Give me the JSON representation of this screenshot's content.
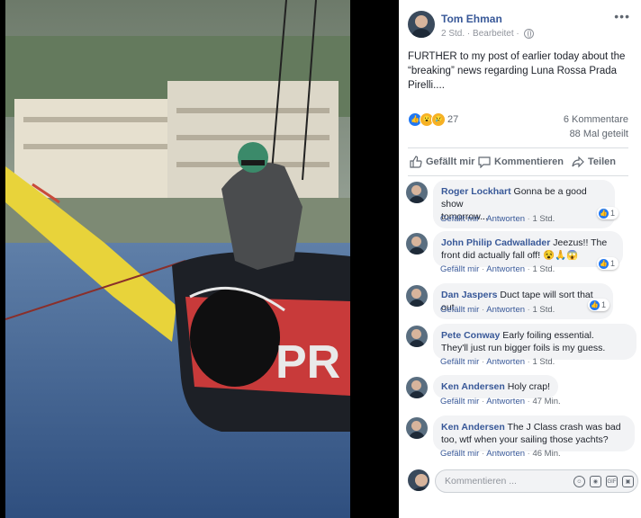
{
  "post": {
    "author": "Tom Ehman",
    "time": "2 Std.",
    "edited": "Bearbeitet",
    "separator": "·",
    "text": "FURTHER to my post of earlier today about the “breaking” news regarding Luna Rossa Prada Pirelli....",
    "reaction_count": "27",
    "comments_count": "6 Kommentare",
    "shares_count": "88 Mal geteilt",
    "photo_text": "PR"
  },
  "actions": {
    "like": "Gefällt mir",
    "comment": "Kommentieren",
    "share": "Teilen"
  },
  "comments": [
    {
      "name": "Roger Lockhart",
      "text": "Gonna be a good show tomorrow...",
      "line1": "Gonna be a good show",
      "line2": "tomorrow...",
      "like": "Gefällt mir",
      "reply": "Antworten",
      "time": "1 Std.",
      "likes": "1"
    },
    {
      "name": "John Philip Cadwallader",
      "line1": "Jeezus!! The",
      "line2": "front did actually fall off! 😵🙏😱",
      "like": "Gefällt mir",
      "reply": "Antworten",
      "time": "1 Std.",
      "likes": "1"
    },
    {
      "name": "Dan Jaspers",
      "line1": "Duct tape will sort that out",
      "like": "Gefällt mir",
      "reply": "Antworten",
      "time": "1 Std.",
      "likes": "1"
    },
    {
      "name": "Pete Conway",
      "line1": "Early foiling essential.",
      "line2": "They'll just run bigger foils is my guess.",
      "like": "Gefällt mir",
      "reply": "Antworten",
      "time": "1 Std."
    },
    {
      "name": "Ken Andersen",
      "line1": "Holy crap!",
      "like": "Gefällt mir",
      "reply": "Antworten",
      "time": "47 Min."
    },
    {
      "name": "Ken Andersen",
      "line1": "The J Class crash was bad",
      "line2": "too, wtf when your sailing those yachts?",
      "like": "Gefällt mir",
      "reply": "Antworten",
      "time": "46 Min."
    }
  ],
  "composer": {
    "placeholder": "Kommentieren ..."
  },
  "icons": {
    "more": "more-icon",
    "globe": "globe-icon",
    "like": "like-icon",
    "comment": "comment-icon",
    "share": "share-icon",
    "emoji": "emoji-icon",
    "camera": "camera-icon",
    "gif": "gif-icon",
    "sticker": "sticker-icon"
  },
  "colors": {
    "link": "#385898",
    "like_blue": "#2078f4",
    "bubble": "#f2f3f5"
  }
}
